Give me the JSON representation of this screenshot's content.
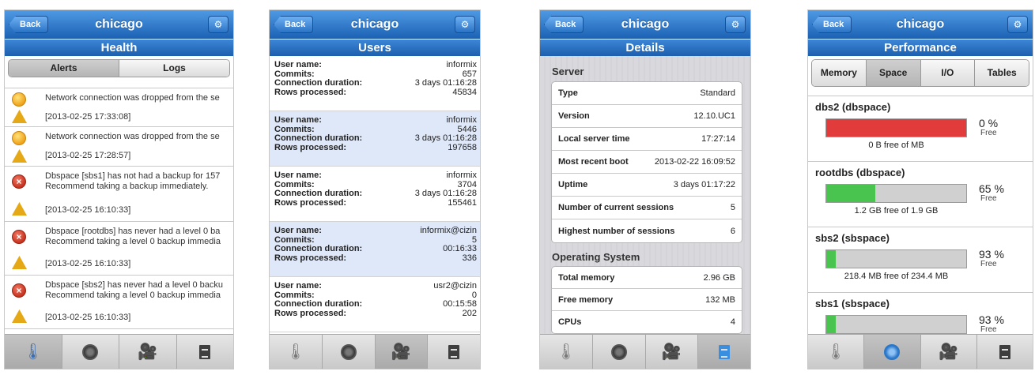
{
  "app_title": "chicago",
  "back_label": "Back",
  "config_glyph": "⚙",
  "tab_icons": [
    "thermometer-icon",
    "gauge-icon",
    "cameras-icon",
    "book-icon"
  ],
  "colors": {
    "header_blue": "#1d63b5",
    "alert_orange": "#f0a21a",
    "alert_red": "#c8321e",
    "bar_red": "#e23b3b",
    "bar_green": "#48c44f",
    "user_alt_row": "#dfe8f8"
  },
  "health": {
    "title": "Health",
    "segments": [
      "Alerts",
      "Logs"
    ],
    "active_segment": "Alerts",
    "alerts": [
      {
        "severity": "orange",
        "lines": [
          "Network connection was dropped from the se"
        ],
        "time": "[2013-02-25 17:33:08]"
      },
      {
        "severity": "orange",
        "lines": [
          "Network connection was dropped from the se"
        ],
        "time": "[2013-02-25 17:28:57]"
      },
      {
        "severity": "red",
        "lines": [
          "Dbspace [sbs1] has not had a backup for  157",
          "Recommend taking a backup immediately."
        ],
        "time": "[2013-02-25 16:10:33]"
      },
      {
        "severity": "red",
        "lines": [
          "Dbspace [rootdbs] has never had a level 0 ba",
          "Recommend taking a level 0 backup immedia"
        ],
        "time": "[2013-02-25 16:10:33]"
      },
      {
        "severity": "red",
        "lines": [
          "Dbspace [sbs2] has never had a level 0 backu",
          "Recommend taking a level 0 backup immedia"
        ],
        "time": "[2013-02-25 16:10:33]"
      }
    ]
  },
  "users": {
    "title": "Users",
    "field_labels": {
      "user_name": "User name:",
      "commits": "Commits:",
      "connection_duration": "Connection duration:",
      "rows_processed": "Rows processed:"
    },
    "items": [
      {
        "user_name": "informix",
        "commits": "657",
        "connection_duration": "3 days 01:16:28",
        "rows_processed": "45834"
      },
      {
        "user_name": "informix",
        "commits": "5446",
        "connection_duration": "3 days 01:16:28",
        "rows_processed": "197658"
      },
      {
        "user_name": "informix",
        "commits": "3704",
        "connection_duration": "3 days 01:16:28",
        "rows_processed": "155461"
      },
      {
        "user_name": "informix@cizin",
        "commits": "5",
        "connection_duration": "00:16:33",
        "rows_processed": "336"
      },
      {
        "user_name": "usr2@cizin",
        "commits": "0",
        "connection_duration": "00:15:58",
        "rows_processed": "202"
      }
    ]
  },
  "details": {
    "title": "Details",
    "server_heading": "Server",
    "server_rows": [
      {
        "label": "Type",
        "value": "Standard"
      },
      {
        "label": "Version",
        "value": "12.10.UC1"
      },
      {
        "label": "Local server time",
        "value": "17:27:14"
      },
      {
        "label": "Most recent boot",
        "value": "2013-02-22 16:09:52"
      },
      {
        "label": "Uptime",
        "value": "3 days 01:17:22"
      },
      {
        "label": "Number of current sessions",
        "value": "5"
      },
      {
        "label": "Highest number of sessions",
        "value": "6"
      }
    ],
    "os_heading": "Operating System",
    "os_rows": [
      {
        "label": "Total memory",
        "value": "2.96 GB"
      },
      {
        "label": "Free memory",
        "value": "132 MB"
      },
      {
        "label": "CPUs",
        "value": "4"
      }
    ]
  },
  "performance": {
    "title": "Performance",
    "segments": [
      "Memory",
      "Space",
      "I/O",
      "Tables"
    ],
    "active_segment": "Space",
    "free_label": "Free",
    "spaces": [
      {
        "name": "dbs2 (dbspace)",
        "percent": "0 %",
        "used_fraction": 1.0,
        "fill": "red",
        "caption": "0 B free of  MB"
      },
      {
        "name": "rootdbs (dbspace)",
        "percent": "65 %",
        "used_fraction": 0.35,
        "fill": "green",
        "caption": "1.2 GB free of 1.9 GB"
      },
      {
        "name": "sbs2 (sbspace)",
        "percent": "93 %",
        "used_fraction": 0.07,
        "fill": "green",
        "caption": "218.4 MB free of 234.4 MB"
      },
      {
        "name": "sbs1 (sbspace)",
        "percent": "93 %",
        "used_fraction": 0.07,
        "fill": "green",
        "caption": ""
      }
    ]
  }
}
